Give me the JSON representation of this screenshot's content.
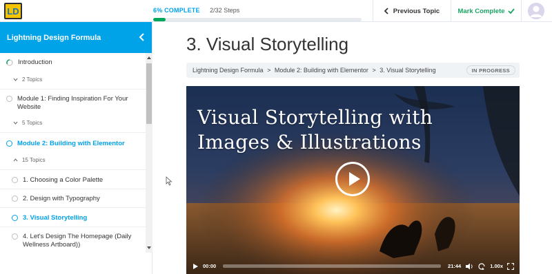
{
  "header": {
    "logo_letters": "LD",
    "progress": {
      "percent_label": "6% COMPLETE",
      "steps_label": "2/32 Steps",
      "fraction": 0.06
    },
    "prev_topic_label": "Previous Topic",
    "mark_complete_label": "Mark Complete"
  },
  "sidebar": {
    "course_title": "Lightning Design Formula",
    "items": [
      {
        "label": "Introduction",
        "topics": "2 Topics"
      },
      {
        "label": "Module 1: Finding Inspiration For Your Website",
        "topics": "5 Topics"
      },
      {
        "label": "Module 2: Building with Elementor",
        "topics": "15 Topics"
      }
    ],
    "subtopics": [
      {
        "label": "1. Choosing a Color Palette"
      },
      {
        "label": "2. Design with Typography"
      },
      {
        "label": "3. Visual Storytelling"
      },
      {
        "label": "4. Let's Design The Homepage (Daily Wellness Artboard))"
      }
    ]
  },
  "main": {
    "page_title": "3. Visual Storytelling",
    "breadcrumb": {
      "course": "Lightning Design Formula",
      "sep": ">",
      "module": "Module 2: Building with Elementor",
      "lesson": "3. Visual Storytelling"
    },
    "status_badge": "IN PROGRESS",
    "video": {
      "title_line1": "Visual Storytelling with",
      "title_line2": "Images & Illustrations",
      "current_time": "00:00",
      "duration": "21:44",
      "speed": "1.00x"
    }
  },
  "colors": {
    "accent": "#00a2e8",
    "complete_green": "#1aa564",
    "progress_fill": "#00a65a"
  }
}
